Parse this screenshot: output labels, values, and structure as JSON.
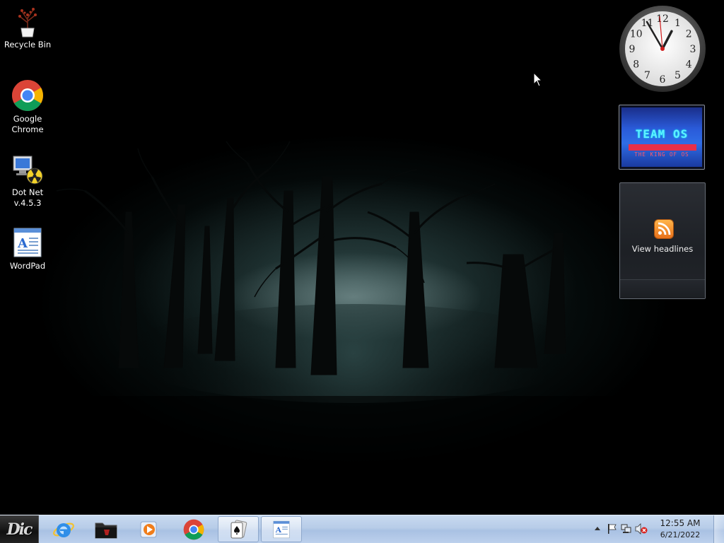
{
  "desktop": {
    "icons": [
      {
        "label": "Recycle Bin",
        "icon": "recycle-bin-plant-icon"
      },
      {
        "label": "Google Chrome",
        "icon": "chrome-icon"
      },
      {
        "label": "Dot Net v.4.5.3",
        "icon": "dotnet-installer-icon"
      },
      {
        "label": "WordPad",
        "icon": "wordpad-icon"
      }
    ]
  },
  "gadgets": {
    "clock": {
      "numbers": [
        "12",
        "1",
        "2",
        "3",
        "4",
        "5",
        "6",
        "7",
        "8",
        "9",
        "10",
        "11"
      ],
      "hour": 12,
      "minute": 55
    },
    "team": {
      "title": "TEAM OS",
      "subtitle": "THE KING OF OS"
    },
    "feed": {
      "label": "View headlines",
      "icon": "rss-icon"
    }
  },
  "taskbar": {
    "start_text": "Dic",
    "buttons": [
      {
        "name": "internet-explorer",
        "icon": "internet-explorer-icon",
        "open": false
      },
      {
        "name": "file-explorer",
        "icon": "folder-icon",
        "open": false
      },
      {
        "name": "media-player",
        "icon": "media-player-icon",
        "open": false
      },
      {
        "name": "chrome",
        "icon": "chrome-icon",
        "open": false
      },
      {
        "name": "solitaire",
        "icon": "spade-card-icon",
        "open": true
      },
      {
        "name": "wordpad",
        "icon": "wordpad-icon",
        "open": true
      }
    ],
    "tray": {
      "time": "12:55 AM",
      "date": "6/21/2022"
    }
  },
  "colors": {
    "taskbar": "#b7cce8",
    "rss": "#f08a24",
    "team_text": "#5ff0ff",
    "team_bar": "#e8304a"
  }
}
